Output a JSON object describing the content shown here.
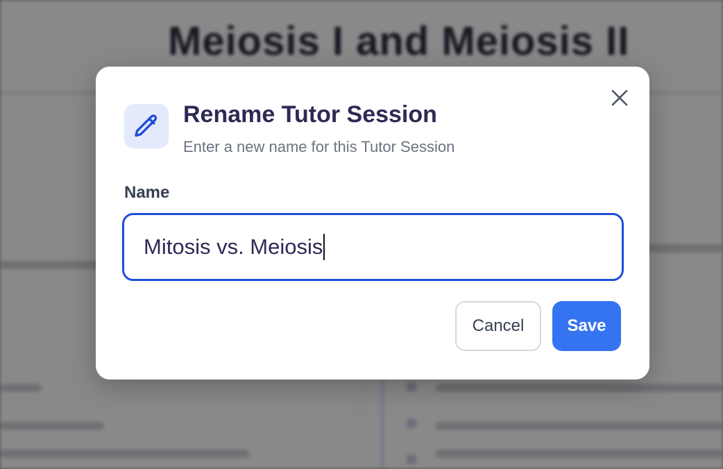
{
  "background": {
    "page_title": "Meiosis I and Meiosis II"
  },
  "dialog": {
    "title": "Rename Tutor Session",
    "subtitle": "Enter a new name for this Tutor Session",
    "icon": "pencil-icon",
    "close_icon": "close-icon",
    "field_label": "Name",
    "field_value": "Mitosis vs. Meiosis",
    "cancel_label": "Cancel",
    "save_label": "Save"
  },
  "colors": {
    "accent": "#3574f0",
    "focus_border": "#1d4ed8",
    "title_text": "#2d2a55",
    "icon_bg": "#e4eafc"
  }
}
